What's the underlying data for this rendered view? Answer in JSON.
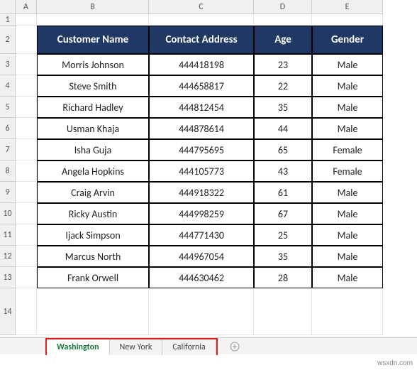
{
  "columns": [
    "A",
    "B",
    "C",
    "D",
    "E"
  ],
  "rowNumbers": [
    1,
    2,
    3,
    4,
    5,
    6,
    7,
    8,
    9,
    10,
    11,
    12,
    13,
    14
  ],
  "table": {
    "headers": {
      "name": "Customer Name",
      "contact": "Contact Address",
      "age": "Age",
      "gender": "Gender"
    },
    "rows": [
      {
        "name": "Morris Johnson",
        "contact": "444418198",
        "age": "23",
        "gender": "Male"
      },
      {
        "name": "Steve Smith",
        "contact": "444658817",
        "age": "22",
        "gender": "Male"
      },
      {
        "name": "Richard Hadley",
        "contact": "444812454",
        "age": "35",
        "gender": "Male"
      },
      {
        "name": "Usman Khaja",
        "contact": "444878614",
        "age": "44",
        "gender": "Male"
      },
      {
        "name": "Isha Guja",
        "contact": "444795695",
        "age": "65",
        "gender": "Female"
      },
      {
        "name": "Angela Hopkins",
        "contact": "444105773",
        "age": "43",
        "gender": "Female"
      },
      {
        "name": "Craig Arvin",
        "contact": "444918322",
        "age": "61",
        "gender": "Male"
      },
      {
        "name": "Ricky Austin",
        "contact": "444998259",
        "age": "67",
        "gender": "Male"
      },
      {
        "name": "Ijack Simpson",
        "contact": "444771430",
        "age": "25",
        "gender": "Male"
      },
      {
        "name": "Marcus North",
        "contact": "444967054",
        "age": "35",
        "gender": "Male"
      },
      {
        "name": "Frank Orwell",
        "contact": "444630462",
        "age": "28",
        "gender": "Male"
      }
    ]
  },
  "tabs": {
    "items": [
      {
        "label": "Washington",
        "active": true
      },
      {
        "label": "New York",
        "active": false
      },
      {
        "label": "California",
        "active": false
      }
    ],
    "add": "+"
  },
  "nav": {
    "prev": "◄",
    "next": "►"
  },
  "watermark": "wsxdn.com"
}
